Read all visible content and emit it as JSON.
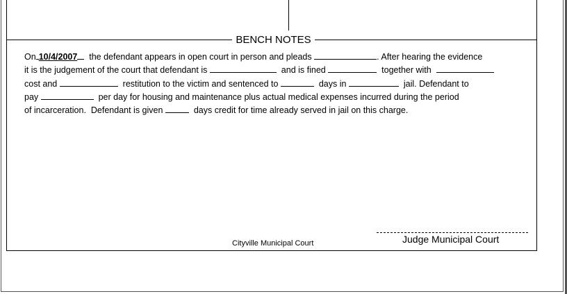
{
  "section_title": "BENCH NOTES",
  "notes": {
    "l1_a": "On",
    "date": "10/4/2007",
    "l1_b": "  the defendant appears in open court in person and pleads ",
    "l1_c": ". After hearing the evidence",
    "l2_a": "it is the judgement of the court that defendant is ",
    "l2_b": "  and is fined ",
    "l2_c": "  together with  ",
    "l3_a": "cost and ",
    "l3_b": "  restitution to the victim and sentenced to ",
    "l3_c": "  days in ",
    "l3_d": "  jail. Defendant to",
    "l4_a": "pay ",
    "l4_b": "  per day for housing and maintenance plus actual medical expenses incurred during the period",
    "l5_a": "of incarceration.  Defendant is given ",
    "l5_b": "  days credit for time already served in jail on this charge."
  },
  "footer": {
    "court_name": "Cityville Municipal Court",
    "signature_label": "Judge Municipal Court"
  }
}
